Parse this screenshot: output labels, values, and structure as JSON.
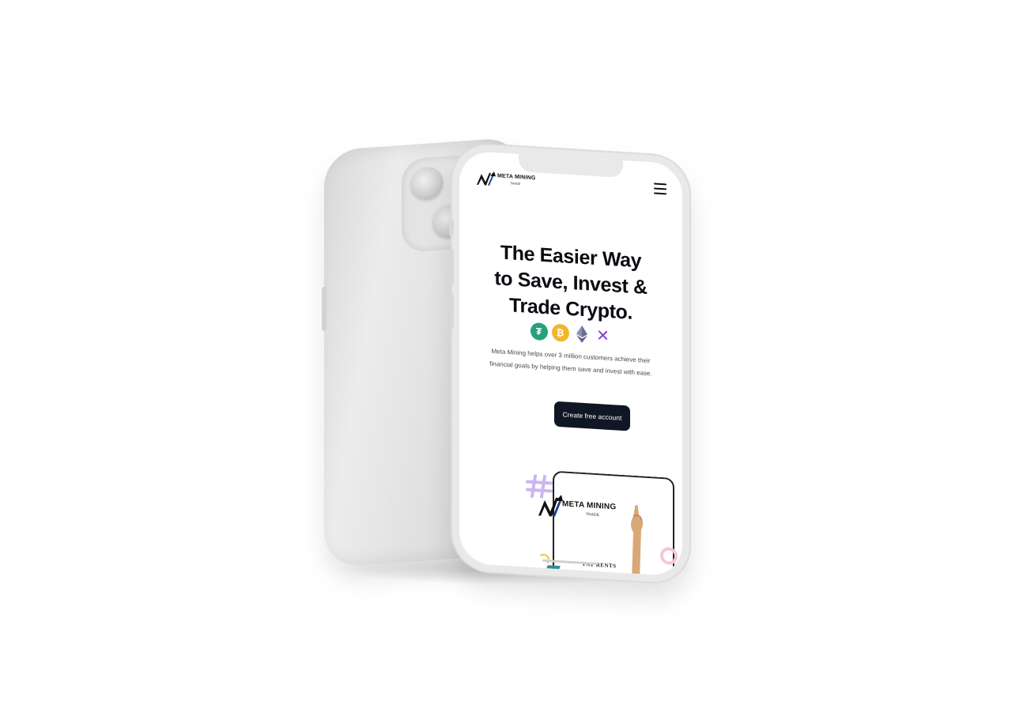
{
  "nav": {
    "logo_title": "META MINING",
    "logo_subtitle": "TRADE",
    "menu_icon": "hamburger-icon"
  },
  "hero": {
    "title_lines": [
      "The Easier Way",
      "to Save, Invest &",
      "Trade Crypto."
    ],
    "coins": [
      {
        "name": "tether-icon",
        "glyph": "₮",
        "color": "#26a17b"
      },
      {
        "name": "bitcoin-icon",
        "glyph": "₿",
        "color": "#f4b52b"
      },
      {
        "name": "ethereum-icon",
        "glyph": "",
        "color": "#8a92b2"
      },
      {
        "name": "xrp-icon",
        "glyph": "✕",
        "color": "#7b3fe4"
      }
    ],
    "description": "Meta Mining helps over 3 million customers achieve their financial goals by helping them save and invest with ease.",
    "cta_label": "Create free account"
  },
  "preview": {
    "logo_title": "META MINING",
    "logo_subtitle": "TRADE",
    "bottom_text": "PAY RENTS"
  },
  "colors": {
    "cta_bg": "#0f1724",
    "text_dark": "#0b0b12",
    "accent_purple": "#7b3fe4"
  }
}
